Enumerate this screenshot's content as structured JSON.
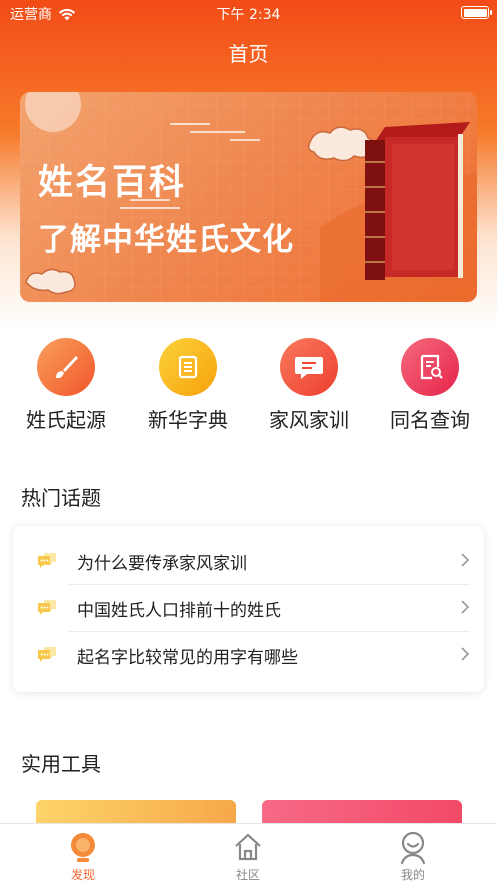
{
  "status_bar": {
    "carrier": "运营商",
    "time": "下午 2:34"
  },
  "header": {
    "title": "首页"
  },
  "banner": {
    "title": "姓名百科",
    "subtitle": "了解中华姓氏文化"
  },
  "quick_entries": [
    {
      "label": "姓氏起源",
      "icon": "brush-icon",
      "color": "#f4662c"
    },
    {
      "label": "新华字典",
      "icon": "book-icon",
      "color": "#f8b10d"
    },
    {
      "label": "家风家训",
      "icon": "message-icon",
      "color": "#f2553e"
    },
    {
      "label": "同名查询",
      "icon": "document-search-icon",
      "color": "#ef3f5a"
    }
  ],
  "hot_topics": {
    "title": "热门话题",
    "items": [
      {
        "text": "为什么要传承家风家训"
      },
      {
        "text": "中国姓氏人口排前十的姓氏"
      },
      {
        "text": "起名字比较常见的用字有哪些"
      }
    ]
  },
  "tools": {
    "title": "实用工具"
  },
  "tabbar": {
    "active_color": "#f4662c",
    "inactive_color": "#888888",
    "tabs": [
      {
        "label": "发现",
        "icon": "bulb-icon",
        "active": true
      },
      {
        "label": "社区",
        "icon": "home-icon",
        "active": false
      },
      {
        "label": "我的",
        "icon": "user-icon",
        "active": false
      }
    ]
  }
}
